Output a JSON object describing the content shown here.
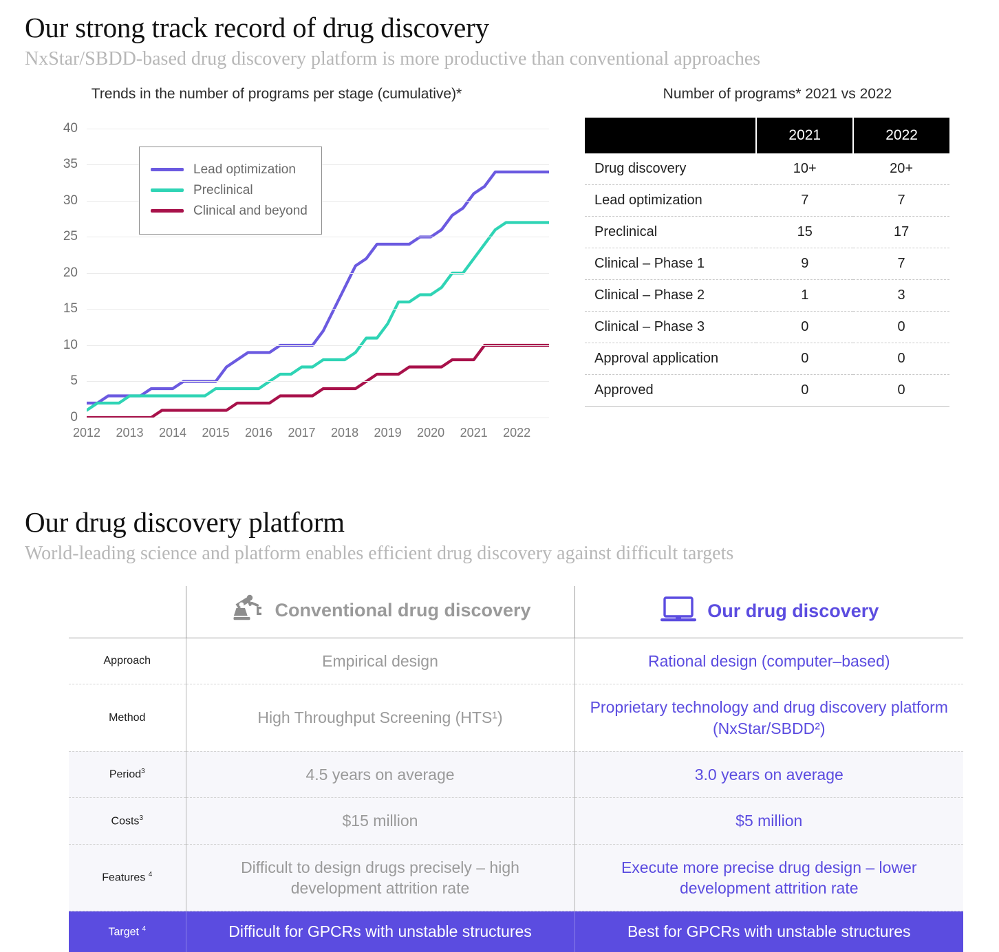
{
  "section1": {
    "title": "Our strong track record of drug discovery",
    "subtitle": "NxStar/SBDD-based drug discovery platform is more productive than conventional approaches"
  },
  "section2": {
    "title": "Our drug discovery platform",
    "subtitle": "World-leading science and platform enables efficient drug discovery against difficult targets"
  },
  "programs_table": {
    "title": "Number of programs*  2021 vs 2022",
    "headers": [
      "",
      "2021",
      "2022"
    ],
    "rows": [
      {
        "label": "Drug discovery",
        "y2021": "10+",
        "y2022": "20+"
      },
      {
        "label": "Lead optimization",
        "y2021": "7",
        "y2022": "7"
      },
      {
        "label": "Preclinical",
        "y2021": "15",
        "y2022": "17"
      },
      {
        "label": "Clinical – Phase 1",
        "y2021": "9",
        "y2022": "7"
      },
      {
        "label": "Clinical – Phase 2",
        "y2021": "1",
        "y2022": "3"
      },
      {
        "label": "Clinical – Phase 3",
        "y2021": "0",
        "y2022": "0"
      },
      {
        "label": "Approval application",
        "y2021": "0",
        "y2022": "0"
      },
      {
        "label": "Approved",
        "y2021": "0",
        "y2022": "0"
      }
    ]
  },
  "comparison": {
    "header": {
      "conventional": "Conventional drug discovery",
      "ours": "Our drug discovery",
      "conventional_icon": "robot-arm-icon",
      "ours_icon": "laptop-icon"
    },
    "rows": [
      {
        "label": "Approach",
        "label_sup": "",
        "conventional": "Empirical design",
        "ours": "Rational design (computer–based)",
        "tinted": false,
        "highlight": false
      },
      {
        "label": "Method",
        "label_sup": "",
        "conventional": "High Throughput Screening (HTS¹)",
        "ours": "Proprietary technology and drug discovery platform (NxStar/SBDD²)",
        "tinted": false,
        "highlight": false
      },
      {
        "label": "Period",
        "label_sup": "3",
        "conventional": "4.5 years on average",
        "ours": "3.0 years on average",
        "tinted": true,
        "highlight": false
      },
      {
        "label": "Costs",
        "label_sup": "3",
        "conventional": "$15 million",
        "ours": "$5 million",
        "tinted": true,
        "highlight": false
      },
      {
        "label": "Features ",
        "label_sup": "4",
        "conventional": "Difficult to design drugs precisely – high development attrition rate",
        "ours": "Execute more precise drug design – lower development attrition rate",
        "tinted": true,
        "highlight": false
      },
      {
        "label": "Target ",
        "label_sup": "4",
        "conventional": "Difficult for GPCRs with unstable structures",
        "ours": "Best for GPCRs with unstable structures",
        "tinted": false,
        "highlight": true
      }
    ]
  },
  "colors": {
    "accent_purple": "#5b4ce0",
    "line_lead": "#6B5AE0",
    "line_preclinical": "#2FD4B5",
    "line_clinical": "#A8114A",
    "muted_gray": "#9a9a9a"
  },
  "chart_data": {
    "type": "line",
    "title": "Trends in the number of programs per stage (cumulative)*",
    "xlabel": "",
    "ylabel": "",
    "ylim": [
      0,
      40
    ],
    "yticks": [
      0,
      5,
      10,
      15,
      20,
      25,
      30,
      35,
      40
    ],
    "xlim": [
      2012,
      2022.75
    ],
    "grid": true,
    "legend_position": "upper-left-inset",
    "categories": [
      "2012",
      "2013",
      "2014",
      "2015",
      "2016",
      "2017",
      "2018",
      "2019",
      "2020",
      "2021",
      "2022"
    ],
    "x": [
      2012,
      2012.25,
      2012.5,
      2012.75,
      2013,
      2013.25,
      2013.5,
      2013.75,
      2014,
      2014.25,
      2014.5,
      2014.75,
      2015,
      2015.25,
      2015.5,
      2015.75,
      2016,
      2016.25,
      2016.5,
      2016.75,
      2017,
      2017.25,
      2017.5,
      2017.75,
      2018,
      2018.25,
      2018.5,
      2018.75,
      2019,
      2019.25,
      2019.5,
      2019.75,
      2020,
      2020.25,
      2020.5,
      2020.75,
      2021,
      2021.25,
      2021.5,
      2021.75,
      2022,
      2022.25,
      2022.5,
      2022.75
    ],
    "series": [
      {
        "name": "Lead optimization",
        "color": "#6B5AE0",
        "values": [
          2,
          2,
          3,
          3,
          3,
          3,
          4,
          4,
          4,
          5,
          5,
          5,
          5,
          7,
          8,
          9,
          9,
          9,
          10,
          10,
          10,
          10,
          12,
          15,
          18,
          21,
          22,
          24,
          24,
          24,
          24,
          25,
          25,
          26,
          28,
          29,
          31,
          32,
          34,
          34,
          34,
          34,
          34,
          34
        ]
      },
      {
        "name": "Preclinical",
        "color": "#2FD4B5",
        "values": [
          1,
          2,
          2,
          2,
          3,
          3,
          3,
          3,
          3,
          3,
          3,
          3,
          4,
          4,
          4,
          4,
          4,
          5,
          6,
          6,
          7,
          7,
          8,
          8,
          8,
          9,
          11,
          11,
          13,
          16,
          16,
          17,
          17,
          18,
          20,
          20,
          22,
          24,
          26,
          27,
          27,
          27,
          27,
          27
        ]
      },
      {
        "name": "Clinical and beyond",
        "color": "#A8114A",
        "values": [
          0,
          0,
          0,
          0,
          0,
          0,
          0,
          1,
          1,
          1,
          1,
          1,
          1,
          1,
          2,
          2,
          2,
          2,
          3,
          3,
          3,
          3,
          4,
          4,
          4,
          4,
          5,
          6,
          6,
          6,
          7,
          7,
          7,
          7,
          8,
          8,
          8,
          10,
          10,
          10,
          10,
          10,
          10,
          10
        ]
      }
    ]
  }
}
